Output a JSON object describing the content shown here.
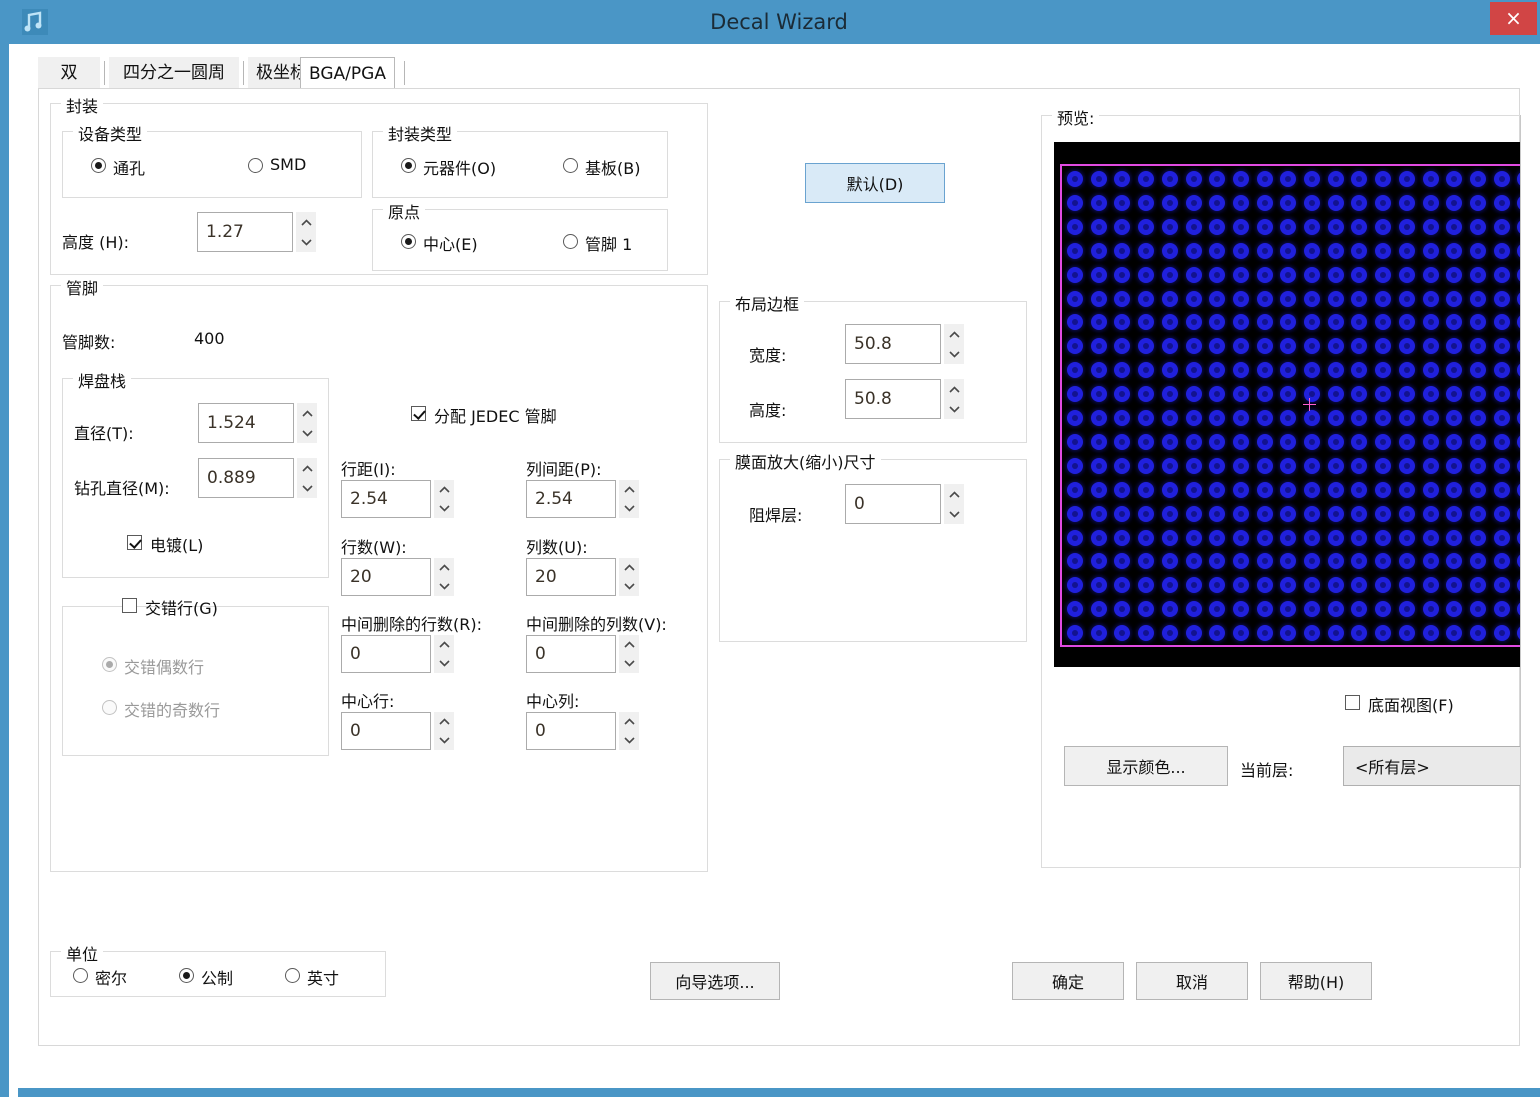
{
  "window": {
    "title": "Decal Wizard",
    "close_label": "×",
    "icon": "decal-wizard-icon"
  },
  "tabs": [
    {
      "label": "双",
      "selected": false
    },
    {
      "label": "四分之一圆周",
      "selected": false
    },
    {
      "label": "极坐标",
      "selected": false
    },
    {
      "label": "BGA/PGA",
      "selected": true
    }
  ],
  "package": {
    "caption": "封装",
    "device_type": {
      "caption": "设备类型",
      "options": [
        {
          "label": "通孔",
          "selected": true
        },
        {
          "label": "SMD",
          "selected": false
        }
      ]
    },
    "package_type": {
      "caption": "封装类型",
      "options": [
        {
          "label": "元器件(O)",
          "selected": true
        },
        {
          "label": "基板(B)",
          "selected": false
        }
      ]
    },
    "origin": {
      "caption": "原点",
      "options": [
        {
          "label": "中心(E)",
          "selected": true
        },
        {
          "label": "管脚 1",
          "selected": false
        }
      ]
    },
    "height": {
      "label": "高度 (H):",
      "value": "1.27"
    }
  },
  "pins": {
    "caption": "管脚",
    "pin_count": {
      "label": "管脚数:",
      "value": "400"
    },
    "padstack": {
      "caption": "焊盘栈",
      "diameter": {
        "label": "直径(T):",
        "value": "1.524"
      },
      "drill_diameter": {
        "label": "钻孔直径(M):",
        "value": "0.889"
      },
      "plated": {
        "label": "电镀(L)",
        "checked": true
      }
    },
    "stagger": {
      "checkbox": {
        "label": "交错行(G)",
        "checked": false
      },
      "options": [
        {
          "label": "交错偶数行",
          "selected": true
        },
        {
          "label": "交错的奇数行",
          "selected": false
        }
      ]
    },
    "jedec": {
      "label": "分配 JEDEC 管脚",
      "checked": true
    },
    "fields": [
      {
        "label": "行距(I):",
        "value": "2.54"
      },
      {
        "label": "列间距(P):",
        "value": "2.54"
      },
      {
        "label": "行数(W):",
        "value": "20"
      },
      {
        "label": "列数(U):",
        "value": "20"
      },
      {
        "label": "中间删除的行数(R):",
        "value": "0"
      },
      {
        "label": "中间删除的列数(V):",
        "value": "0"
      },
      {
        "label": "中心行:",
        "value": "0"
      },
      {
        "label": "中心列:",
        "value": "0"
      }
    ]
  },
  "defaults_button": {
    "label": "默认(D)"
  },
  "layout_border": {
    "caption": "布局边框",
    "width": {
      "label": "宽度:",
      "value": "50.8"
    },
    "height": {
      "label": "高度:",
      "value": "50.8"
    }
  },
  "swell": {
    "caption": "膜面放大(缩小)尺寸",
    "solder_mask": {
      "label": "阻焊层:",
      "value": "0"
    }
  },
  "preview": {
    "caption": "预览:",
    "bottom_view": {
      "label": "底面视图(F)",
      "checked": false
    },
    "display_colors_button": {
      "label": "显示颜色..."
    },
    "current_layer_label": "当前层:",
    "current_layer_value": "<所有层>",
    "colors": {
      "background": "#000000",
      "pad": "#2020dd",
      "drill": "#13138f",
      "outline": "#e24be2",
      "origin_marker": "#ff5fd0"
    },
    "grid": {
      "rows": 20,
      "cols": 20
    }
  },
  "units": {
    "caption": "单位",
    "options": [
      {
        "label": "密尔",
        "selected": false
      },
      {
        "label": "公制",
        "selected": true
      },
      {
        "label": "英寸",
        "selected": false
      }
    ]
  },
  "footer": {
    "wizard_options": "向导选项...",
    "ok": "确定",
    "cancel": "取消",
    "help": "帮助(H)"
  },
  "theme": {
    "titlebar": "#4a96c6",
    "close": "#d14545",
    "accent": "#d9eaf7"
  }
}
